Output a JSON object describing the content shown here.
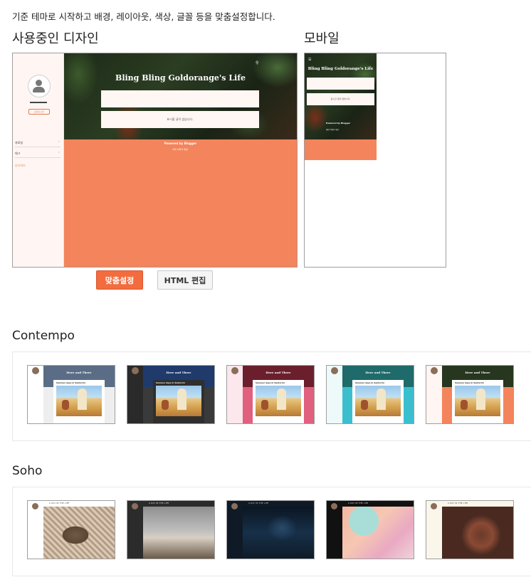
{
  "intro": "기준 테마로 시작하고 배경, 레이아웃, 색상, 글꼴 등을 맞춤설정합니다.",
  "current": {
    "heading": "사용중인 디자인",
    "blog_title": "Bling Bling Goldorange's Life",
    "profile_button": "프로필 보기",
    "nav_items": [
      {
        "label": "자료실"
      },
      {
        "label": "태그"
      }
    ],
    "nav_link": "신고하기",
    "empty_post_message": "표시할 글이 없습니다.",
    "powered_by": "Powered by Blogger",
    "footer_text": "테마 이미지 제공:"
  },
  "mobile": {
    "heading": "모바일",
    "blog_title": "Bling Bling Goldorange's Life",
    "empty_post_message": "표시할 글이 없습니다.",
    "powered_by": "Powered by Blogger",
    "footer_text": "테마 이미지 제공:"
  },
  "buttons": {
    "customize": "맞춤설정",
    "edit_html": "HTML 편집"
  },
  "themes": {
    "contempo": {
      "heading": "Contempo",
      "blog_title": "Here and There",
      "post_title": "Summer days in Santorini",
      "variants": [
        {
          "head": "#5b6d86",
          "side": "#ffffff",
          "bottom": "#eeeeee",
          "card": "#ffffff"
        },
        {
          "head": "#1f3a6b",
          "side": "#2a2a2a",
          "bottom": "#3a3a3a",
          "card": "#2f2f2f"
        },
        {
          "head": "#6b1f2d",
          "side": "#fbe7ec",
          "bottom": "#e0607e",
          "card": "#ffffff"
        },
        {
          "head": "#1f6b6b",
          "side": "#eefafa",
          "bottom": "#3bbfcf",
          "card": "#ffffff"
        },
        {
          "head": "#26361f",
          "side": "#fff6f3",
          "bottom": "#f3845b",
          "card": "#ffffff"
        }
      ]
    },
    "soho": {
      "heading": "Soho",
      "blog_name": "A DAY IN THE LIFE",
      "variants": [
        {
          "side": "#ffffff",
          "head": "#ffffff",
          "text": "#333333",
          "image": "cat"
        },
        {
          "side": "#2b2b2b",
          "head": "#2b2b2b",
          "text": "#eeeeee",
          "image": "living-room"
        },
        {
          "side": "#0f1a26",
          "head": "#0f1a26",
          "text": "#dddddd",
          "image": "cockpit"
        },
        {
          "side": "#111111",
          "head": "#111111",
          "text": "#eeeeee",
          "image": "makeup"
        },
        {
          "side": "#fbf6ea",
          "head": "#fbf6ea",
          "text": "#333333",
          "image": "figs"
        }
      ]
    }
  }
}
